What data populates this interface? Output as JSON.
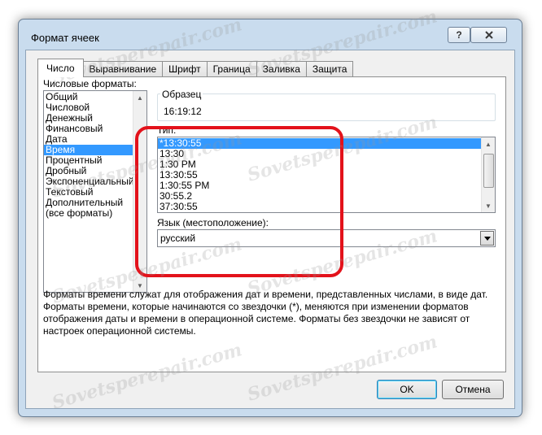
{
  "dialog": {
    "title": "Формат ячеек",
    "help_glyph": "?",
    "close_icon": "close-icon"
  },
  "tabs": [
    "Число",
    "Выравнивание",
    "Шрифт",
    "Граница",
    "Заливка",
    "Защита"
  ],
  "active_tab": 0,
  "formats": {
    "label": "Числовые форматы:",
    "items": [
      "Общий",
      "Числовой",
      "Денежный",
      "Финансовый",
      "Дата",
      "Время",
      "Процентный",
      "Дробный",
      "Экспоненциальный",
      "Текстовый",
      "Дополнительный",
      "(все форматы)"
    ],
    "selected": 5
  },
  "sample": {
    "label": "Образец",
    "value": "16:19:12"
  },
  "type": {
    "label": "Тип:",
    "items": [
      "*13:30:55",
      "13:30",
      "1:30 PM",
      "13:30:55",
      "1:30:55 PM",
      "30:55.2",
      "37:30:55"
    ],
    "selected": 0
  },
  "locale": {
    "label": "Язык (местоположение):",
    "value": "русский"
  },
  "description": "Форматы времени служат для отображения дат и времени, представленных числами, в виде дат. Форматы времени, которые начинаются со звездочки (*), меняются при изменении форматов отображения даты и времени в операционной системе. Форматы без звездочки не зависят от настроек операционной системы.",
  "buttons": {
    "ok": "OK",
    "cancel": "Отмена"
  },
  "watermark": "Sovetsperepair.com",
  "colors": {
    "selection": "#3399ff",
    "highlight_frame": "#e3121b"
  }
}
